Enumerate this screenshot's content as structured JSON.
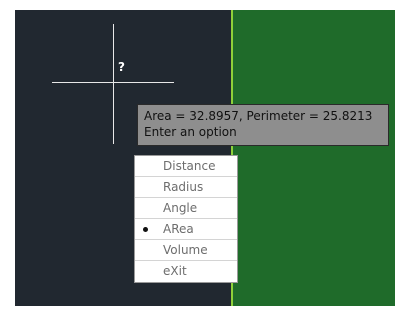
{
  "tooltip": {
    "line1": "Area = 32.8957, Perimeter = 25.8213",
    "line2": "Enter an option"
  },
  "cursor": {
    "label": "?"
  },
  "menu": {
    "items": [
      {
        "label": "Distance",
        "selected": false
      },
      {
        "label": "Radius",
        "selected": false
      },
      {
        "label": "Angle",
        "selected": false
      },
      {
        "label": "ARea",
        "selected": true
      },
      {
        "label": "Volume",
        "selected": false
      },
      {
        "label": "eXit",
        "selected": false
      }
    ]
  },
  "colors": {
    "canvas": "#212830",
    "selected_object": "#1f6b2a",
    "selected_edge": "#8fd13a",
    "tooltip_bg": "#8e8e8e"
  }
}
